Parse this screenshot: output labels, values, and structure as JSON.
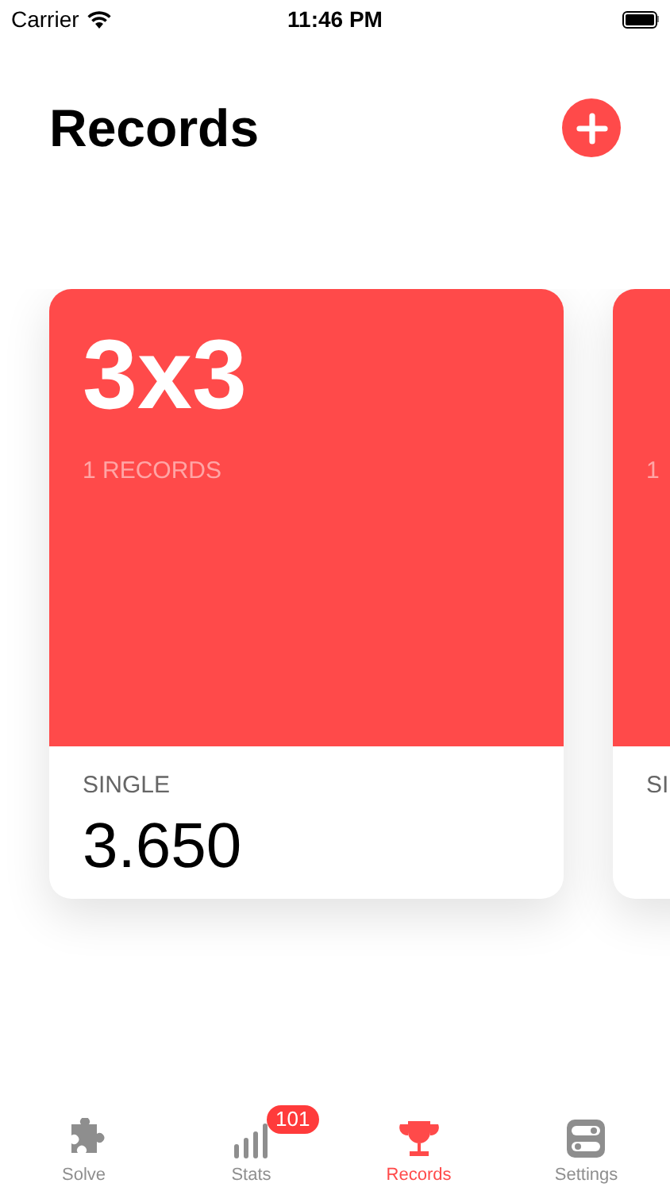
{
  "status_bar": {
    "carrier": "Carrier",
    "time": "11:46 PM"
  },
  "header": {
    "title": "Records"
  },
  "cards": [
    {
      "title": "3x3",
      "subtitle": "1 RECORDS",
      "label": "SINGLE",
      "value": "3.650"
    },
    {
      "subtitle": "1",
      "label": "SI"
    }
  ],
  "tab_bar": [
    {
      "label": "Solve",
      "kind": "puzzle",
      "selected": false
    },
    {
      "label": "Stats",
      "kind": "bars",
      "selected": false,
      "badge": "101"
    },
    {
      "label": "Records",
      "kind": "trophy",
      "selected": true
    },
    {
      "label": "Settings",
      "kind": "toggles",
      "selected": false
    }
  ]
}
